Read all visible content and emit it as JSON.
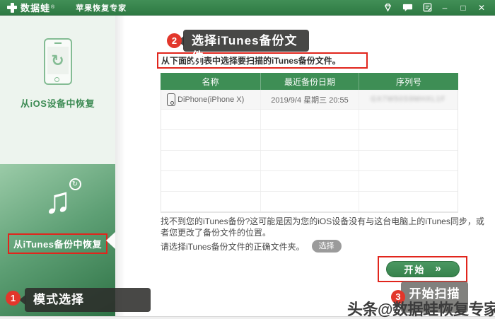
{
  "titlebar": {
    "app_name": "数据蛙",
    "reg_mark": "®",
    "app_subtitle": "苹果恢复专家",
    "window_controls": {
      "minimize": "–",
      "maximize": "□",
      "close": "✕"
    },
    "brand_green": "#3a8a4f"
  },
  "sidebar": {
    "items": [
      {
        "label": "从iOS设备中恢复",
        "selected": false
      },
      {
        "label": "从iTunes备份中恢复",
        "selected": true
      }
    ],
    "selected_gradient": [
      "#9bcba8",
      "#2d7144"
    ]
  },
  "annotations": {
    "step1": {
      "number": "1",
      "label": "模式选择"
    },
    "step2": {
      "number": "2",
      "label": "选择iTunes备份文件"
    },
    "step3": {
      "number": "3",
      "label": "开始扫描"
    },
    "badge_color": "#e2372b",
    "highlight_color": "#e1251c"
  },
  "main": {
    "instruction": "从下面的列表中选择要扫描的iTunes备份文件。",
    "table": {
      "columns": [
        "名称",
        "最近备份日期",
        "序列号"
      ],
      "rows": [
        {
          "name": "DiPhone(iPhone X)",
          "date": "2019/9/4 星期三 20:55",
          "serial_masked": "GX7W50S9MHXL1F"
        }
      ],
      "empty_row_count": 5,
      "header_color": "#3e8e55"
    },
    "note_paragraph": "找不到您的iTunes备份?这可能是因为您的iOS设备没有与这台电脑上的iTunes同步，或者您更改了备份文件的位置。",
    "note_choose": "请选择iTunes备份文件的正确文件夹。",
    "choose_button": "选择",
    "start_button": "开始",
    "start_chevrons": "»",
    "refresh_glyph": "↻",
    "music_glyph": "♫"
  },
  "watermark": "头条@数据蛙恢复专家"
}
